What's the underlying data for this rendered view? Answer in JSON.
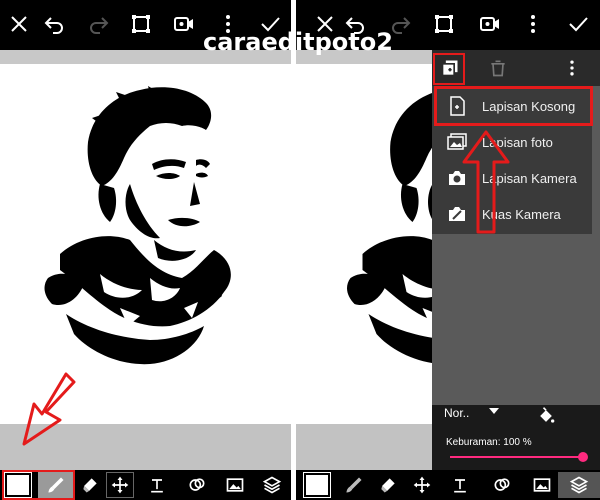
{
  "watermark": "caraeditpoto2",
  "dropdown": {
    "items": [
      {
        "label": "Lapisan Kosong",
        "icon": "blank-layer-icon"
      },
      {
        "label": "Lapisan foto",
        "icon": "photo-layer-icon"
      },
      {
        "label": "Lapisan Kamera",
        "icon": "camera-icon"
      },
      {
        "label": "Kuas Kamera",
        "icon": "camera-brush-icon"
      }
    ]
  },
  "layer_settings": {
    "blend_mode": "Nor..",
    "opacity_label": "Keburaman: 100 %",
    "opacity_value": 100
  },
  "colors": {
    "accent": "#ff2a7f",
    "highlight": "#e41b1b"
  }
}
